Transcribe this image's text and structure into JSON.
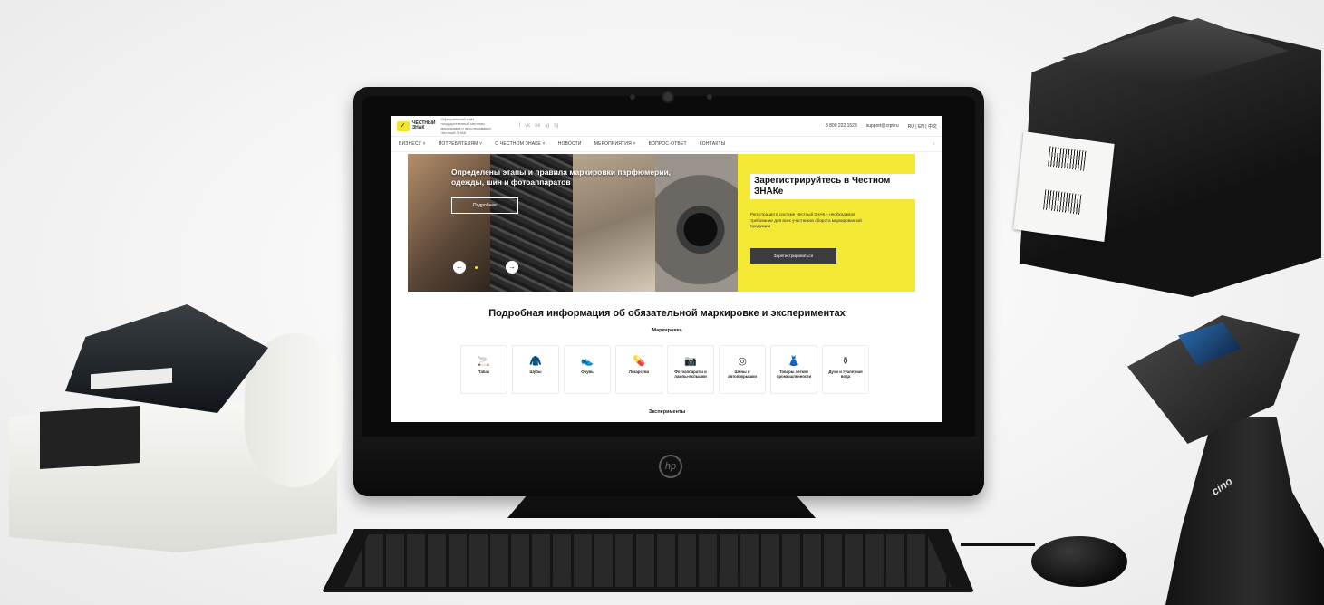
{
  "site": {
    "logo": {
      "line1": "ЧЕСТНЫЙ",
      "line2": "ЗНАК"
    },
    "tagline": "Официальный сайт государственной системы маркировки и прослеживания Честный ЗНАК",
    "social": [
      "f",
      "vk",
      "ok",
      "ig",
      "tg"
    ],
    "phone": "8 800 222 1523",
    "email": "support@crpt.ru",
    "languages": "RU | EN | 中文",
    "nav": [
      "БИЗНЕСУ ˅",
      "ПОТРЕБИТЕЛЯМ ˅",
      "О ЧЕСТНОМ ЗНАКЕ ˅",
      "НОВОСТИ",
      "МЕРОПРИЯТИЯ ˅",
      "ВОПРОС-ОТВЕТ",
      "КОНТАКТЫ"
    ],
    "search_icon": "⌕",
    "hero": {
      "title": "Определены этапы и правила маркировки парфюмерии, одежды, шин и фотоаппаратов",
      "button": "Подробнее"
    },
    "register": {
      "title": "Зарегистрируйтесь в Честном ЗНАКе",
      "text": "Регистрация в системе Честный ЗНАК – необходимое требование для всех участников оборота маркированной продукции",
      "button": "Зарегистрироваться"
    },
    "section_title": "Подробная информация об обязательной маркировке и экспериментах",
    "marking_label": "Маркировка",
    "categories": [
      {
        "label": "Табак",
        "icon": "🚬"
      },
      {
        "label": "Шубы",
        "icon": "🧥"
      },
      {
        "label": "Обувь",
        "icon": "👟"
      },
      {
        "label": "Лекарства",
        "icon": "💊"
      },
      {
        "label": "Фотоаппараты и лампы-вспышки",
        "icon": "📷"
      },
      {
        "label": "Шины и автопокрышки",
        "icon": "◎"
      },
      {
        "label": "Товары легкой промышленности",
        "icon": "👗"
      },
      {
        "label": "Духи и туалетная вода",
        "icon": "⚱"
      }
    ],
    "experiments_label": "Эксперименты"
  },
  "hardware": {
    "monitor_brand": "hp",
    "scanner_brand": "cino"
  }
}
